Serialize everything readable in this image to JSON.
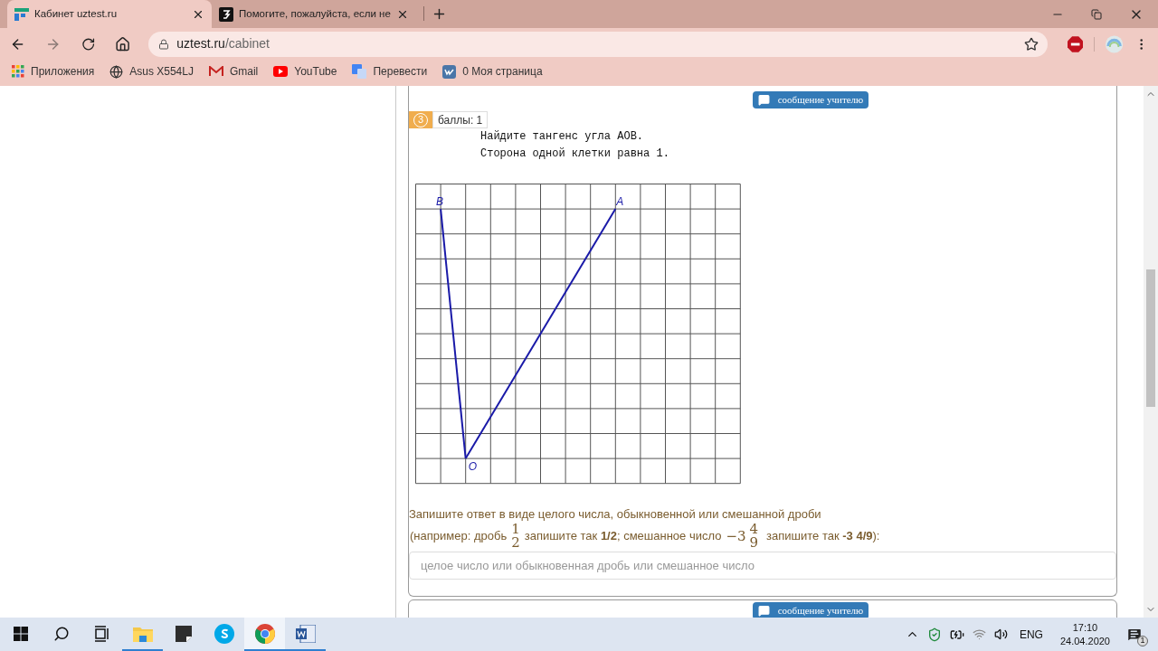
{
  "tabs": [
    {
      "title": "Кабинет uztest.ru",
      "selected": true
    },
    {
      "title": "Помогите, пожалуйста, если не",
      "selected": false
    }
  ],
  "address": {
    "host": "uztest.ru",
    "path": "/cabinet"
  },
  "bookmarks": [
    {
      "kind": "apps",
      "label": "Приложения"
    },
    {
      "kind": "globe",
      "label": "Asus X554LJ"
    },
    {
      "kind": "gmail",
      "label": "Gmail"
    },
    {
      "kind": "youtube",
      "label": "YouTube"
    },
    {
      "kind": "translate",
      "label": "Перевести"
    },
    {
      "kind": "vk",
      "label": "0 Моя страница"
    }
  ],
  "question": {
    "message_button": "сообщение учителю",
    "number": "3",
    "points": "баллы: 1",
    "lines": [
      "Найдите тангенс угла AOB.",
      "Сторона одной клетки равна 1."
    ],
    "figure": {
      "points": [
        {
          "label": "B"
        },
        {
          "label": "A"
        },
        {
          "label": "O"
        }
      ]
    },
    "instruction": "Запишите ответ в виде целого числа, обыкновенной или смешанной дроби",
    "example": [
      {
        "kind": "text",
        "text": "(например: дробь"
      },
      {
        "kind": "fraction",
        "numerator": "1",
        "denominator": "2"
      },
      {
        "kind": "text",
        "text": "запишите так **1/2**; смешанное число"
      },
      {
        "kind": "mixed",
        "whole": "−3",
        "numerator": "4",
        "denominator": "9"
      },
      {
        "kind": "text",
        "text": "запишите так **-3 4/9**):"
      }
    ],
    "answer_placeholder": "целое число или обыкновенная дробь или смешанное число"
  },
  "next_question": {
    "message_button": "сообщение учителю"
  },
  "taskbar": [
    {
      "kind": "start",
      "running": false,
      "selected": false
    },
    {
      "kind": "search",
      "running": false,
      "selected": false
    },
    {
      "kind": "taskview",
      "running": false,
      "selected": false
    },
    {
      "kind": "explorer",
      "running": true,
      "selected": false
    },
    {
      "kind": "notes",
      "running": false,
      "selected": false
    },
    {
      "kind": "skype",
      "running": false,
      "selected": false
    },
    {
      "kind": "chrome",
      "running": true,
      "selected": true
    },
    {
      "kind": "word",
      "running": true,
      "selected": false
    }
  ],
  "tray": {
    "language": "ENG",
    "time": "17:10",
    "date": "24.04.2020",
    "notifications": "1"
  }
}
